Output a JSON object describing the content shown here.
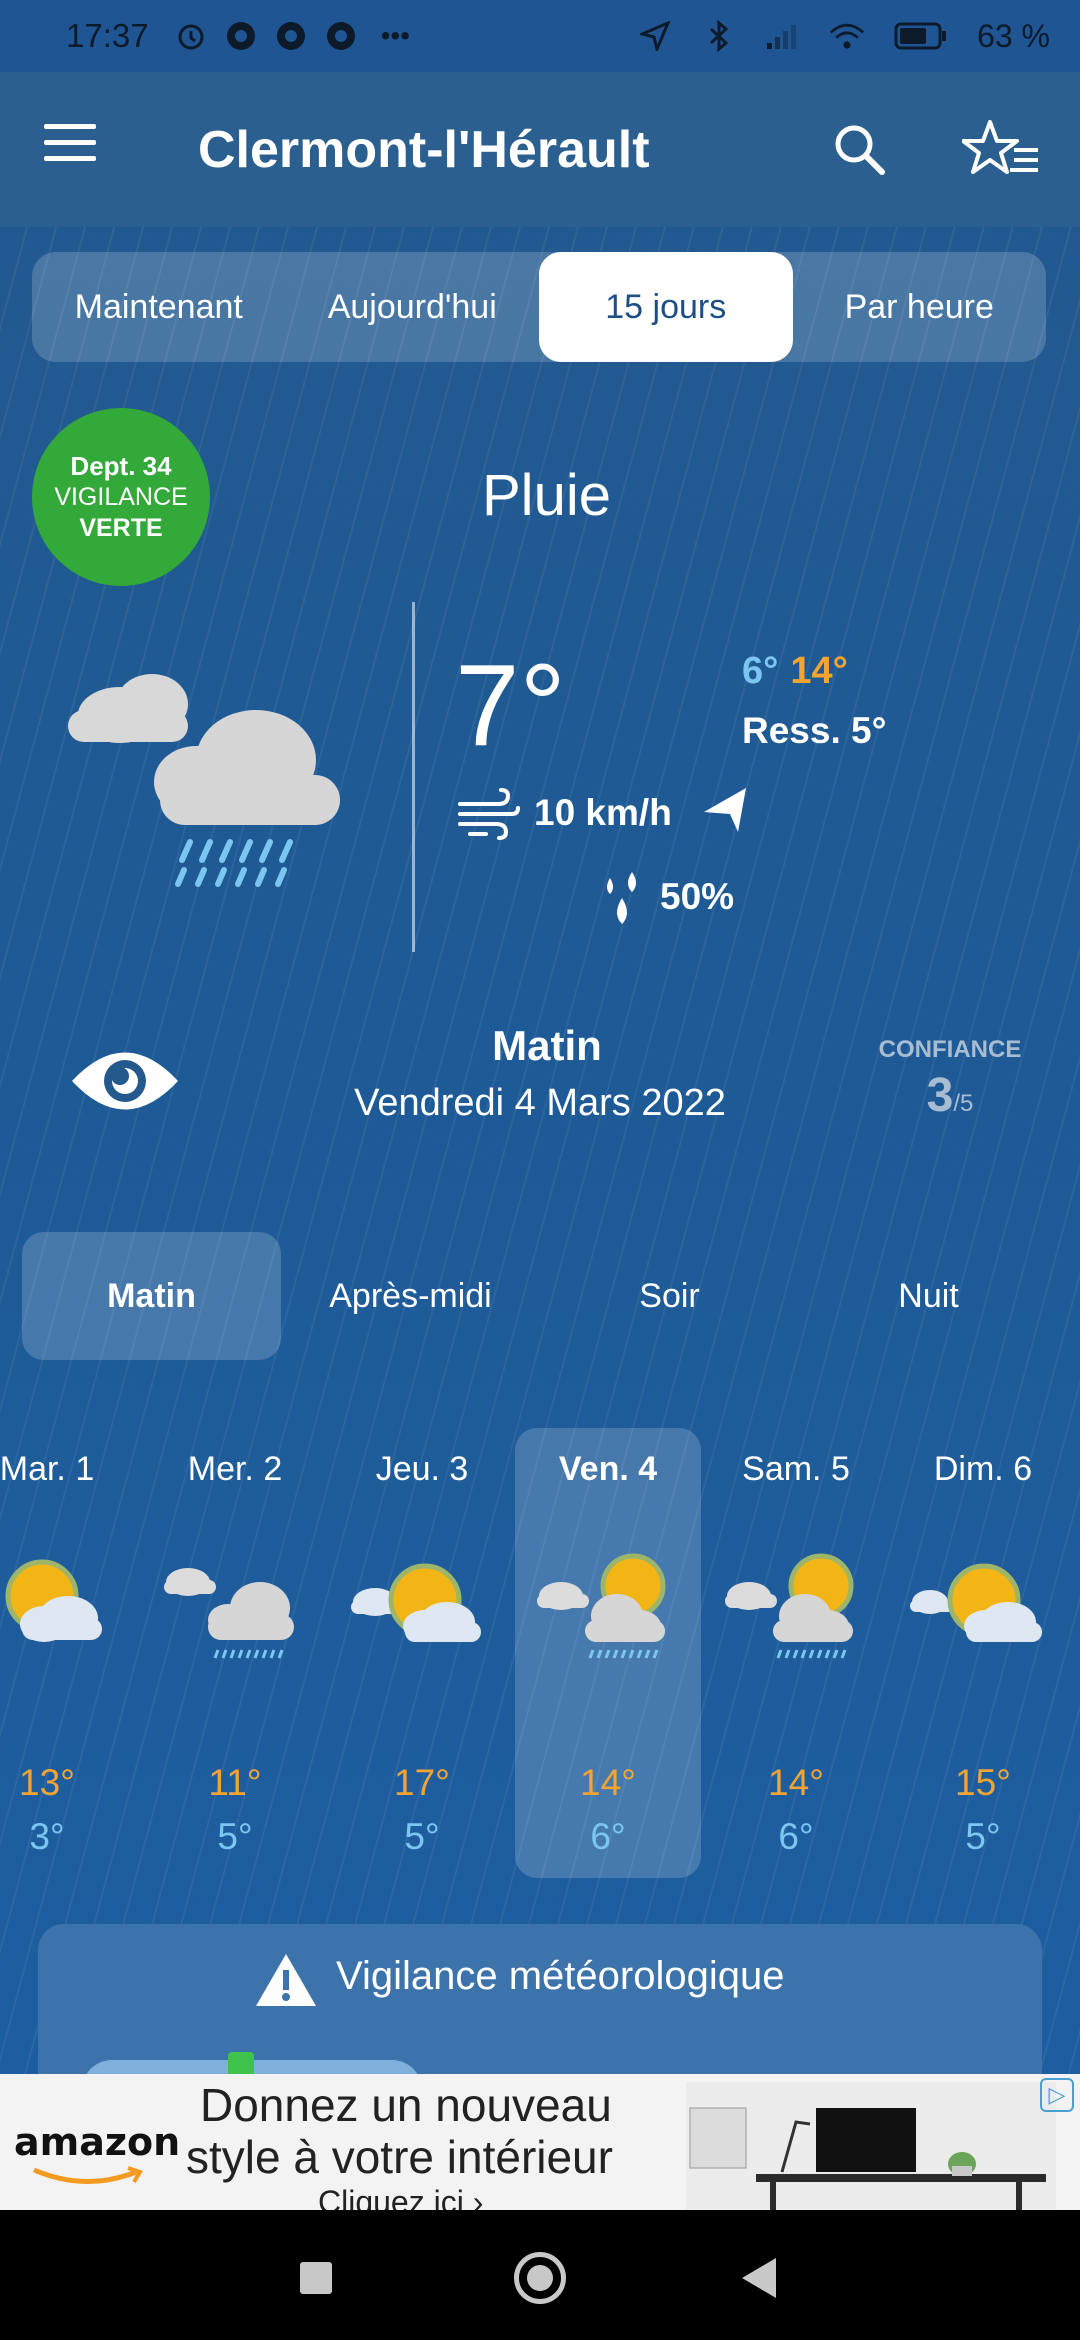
{
  "status_bar": {
    "time": "17:37",
    "more": "•••",
    "battery": "63 %"
  },
  "header": {
    "title": "Clermont-l'Hérault",
    "icons": [
      "menu-icon",
      "search-icon",
      "favorites-list-icon"
    ]
  },
  "tabs": [
    {
      "label": "Maintenant",
      "active": false
    },
    {
      "label": "Aujourd'hui",
      "active": false
    },
    {
      "label": "15 jours",
      "active": true
    },
    {
      "label": "Par heure",
      "active": false
    }
  ],
  "vigilance_badge": {
    "line1": "Dept. 34",
    "line2": "VIGILANCE",
    "line3": "VERTE",
    "color": "#33a93a"
  },
  "current": {
    "condition": "Pluie",
    "icon": "rain-cloud-icon",
    "temp": "7°",
    "min": "6°",
    "max": "14°",
    "feels_like": "Ress. 5°",
    "wind": "10 km/h",
    "precip": "50%"
  },
  "period": {
    "title": "Matin",
    "date": "Vendredi 4 Mars 2022",
    "confidence_label": "CONFIANCE",
    "confidence_value": "3",
    "confidence_max": "/5"
  },
  "period_tabs": [
    {
      "label": "Matin",
      "active": true
    },
    {
      "label": "Après-midi",
      "active": false
    },
    {
      "label": "Soir",
      "active": false
    },
    {
      "label": "Nuit",
      "active": false
    }
  ],
  "days": [
    {
      "name": "Mar. 1",
      "max": "13°",
      "min": "3°",
      "icon": "sun-cloud-icon",
      "active": false
    },
    {
      "name": "Mer. 2",
      "max": "11°",
      "min": "5°",
      "icon": "cloud-drizzle-icon",
      "active": false
    },
    {
      "name": "Jeu. 3",
      "max": "17°",
      "min": "5°",
      "icon": "sun-cloud-icon",
      "active": false
    },
    {
      "name": "Ven. 4",
      "max": "14°",
      "min": "6°",
      "icon": "sun-cloud-drizzle-icon",
      "active": true
    },
    {
      "name": "Sam. 5",
      "max": "14°",
      "min": "6°",
      "icon": "sun-cloud-drizzle-icon",
      "active": false
    },
    {
      "name": "Dim. 6",
      "max": "15°",
      "min": "5°",
      "icon": "sun-cloud-icon",
      "active": false
    }
  ],
  "vigilance_card": {
    "title": "Vigilance météorologique"
  },
  "ad": {
    "brand": "amazon",
    "line1": "Donnez un nouveau",
    "line2": "style à votre intérieur",
    "line3": "Cliquez ici ›"
  },
  "colors": {
    "max_temp": "#f3a432",
    "min_temp": "#7cc6f2",
    "app_bar": "#2b5f8f",
    "background": "#1e5a96"
  }
}
